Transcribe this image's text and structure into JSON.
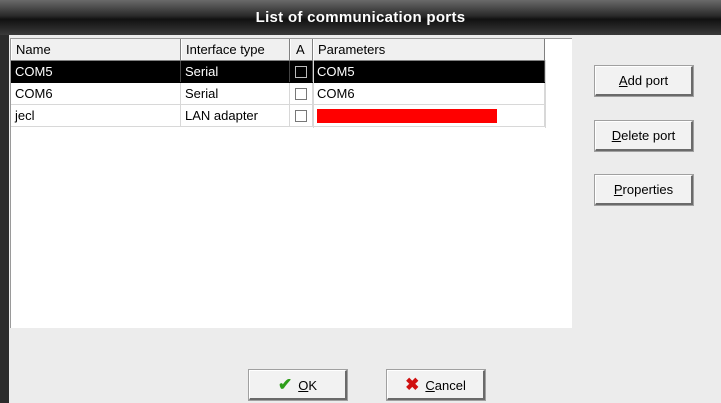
{
  "window": {
    "title": "List of communication ports"
  },
  "table": {
    "columns": [
      "Name",
      "Interface type",
      "A",
      "Parameters"
    ],
    "rows": [
      {
        "name": "COM5",
        "type": "Serial",
        "auto": false,
        "params": "COM5",
        "selected": true
      },
      {
        "name": "COM6",
        "type": "Serial",
        "auto": false,
        "params": "COM6",
        "selected": false
      },
      {
        "name": "jecl",
        "type": "LAN adapter",
        "auto": false,
        "params": "",
        "redacted": true,
        "selected": false
      }
    ]
  },
  "buttons": {
    "add": {
      "key": "A",
      "rest": "dd port"
    },
    "delete": {
      "key": "D",
      "rest": "elete port"
    },
    "properties": {
      "key": "P",
      "rest": "roperties"
    },
    "ok": {
      "key": "O",
      "rest": "K"
    },
    "cancel": {
      "key": "C",
      "rest": "ancel"
    }
  },
  "colors": {
    "selection": "#000000",
    "redaction": "#ff0000",
    "ok_icon": "#2e9e1a",
    "cancel_icon": "#d01010"
  },
  "icons": {
    "ok": "checkmark-icon",
    "cancel": "x-icon"
  }
}
